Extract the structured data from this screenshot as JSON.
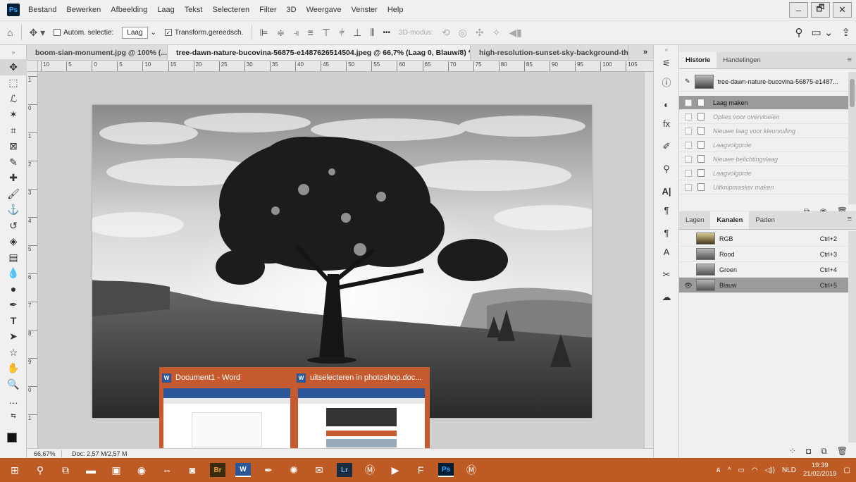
{
  "app": {
    "logo": "Ps",
    "menu": [
      "Bestand",
      "Bewerken",
      "Afbeelding",
      "Laag",
      "Tekst",
      "Selecteren",
      "Filter",
      "3D",
      "Weergave",
      "Venster",
      "Help"
    ],
    "window_controls": [
      "–",
      "🗗",
      "✕"
    ]
  },
  "options": {
    "auto_select_label": "Autom. selectie:",
    "auto_select_value": "Laag",
    "transform_label": "Transform.gereedsch.",
    "more": "•••",
    "mode3d": "3D-modus:"
  },
  "tabs": [
    {
      "label": "boom-sian-monument.jpg @ 100% (...",
      "close": "×"
    },
    {
      "label": "tree-dawn-nature-bucovina-56875-e1487626514504.jpeg @ 66,7% (Laag 0, Blauw/8) *",
      "close": "×"
    },
    {
      "label": "high-resolution-sunset-sky-background-thu",
      "close": ""
    }
  ],
  "tabs_more": "»",
  "ruler_h": [
    "10",
    "5",
    "0",
    "5",
    "10",
    "15",
    "20",
    "25",
    "30",
    "35",
    "40",
    "45",
    "50",
    "55",
    "60",
    "65",
    "70",
    "75",
    "80",
    "85",
    "90",
    "95",
    "100",
    "105"
  ],
  "ruler_v": [
    "1",
    "0",
    "1",
    "2",
    "3",
    "4",
    "5",
    "6",
    "7",
    "8",
    "9",
    "0",
    "1"
  ],
  "status": {
    "zoom": "66,67%",
    "doc": "Doc: 2,57 M/2,57 M"
  },
  "history": {
    "tabs": [
      "Historie",
      "Handelingen"
    ],
    "snapshot": "tree-dawn-nature-bucovina-56875-e1487...",
    "items": [
      "Laag maken",
      "Opties voor overvloeien",
      "Nieuwe laag voor kleurvulling",
      "Laagvolgorde",
      "Nieuwe belichtingslaag",
      "Laagvolgorde",
      "Uitknipmasker maken"
    ]
  },
  "channels": {
    "tabs": [
      "Lagen",
      "Kanalen",
      "Paden"
    ],
    "rows": [
      {
        "name": "RGB",
        "shortcut": "Ctrl+2"
      },
      {
        "name": "Rood",
        "shortcut": "Ctrl+3"
      },
      {
        "name": "Groen",
        "shortcut": "Ctrl+4"
      },
      {
        "name": "Blauw",
        "shortcut": "Ctrl+5"
      }
    ]
  },
  "popup": [
    {
      "title": "Document1 - Word",
      "icon": "W"
    },
    {
      "title": "uitselecteren in photoshop.doc...",
      "icon": "W"
    }
  ],
  "taskbar": {
    "apps": [
      "Br",
      "W",
      "Lr",
      "Ps"
    ],
    "lang": "NLD",
    "time": "19:39",
    "date": "21/02/2019"
  },
  "colors": {
    "taskbar": "#be5a24",
    "accent": "#31a8ff"
  }
}
